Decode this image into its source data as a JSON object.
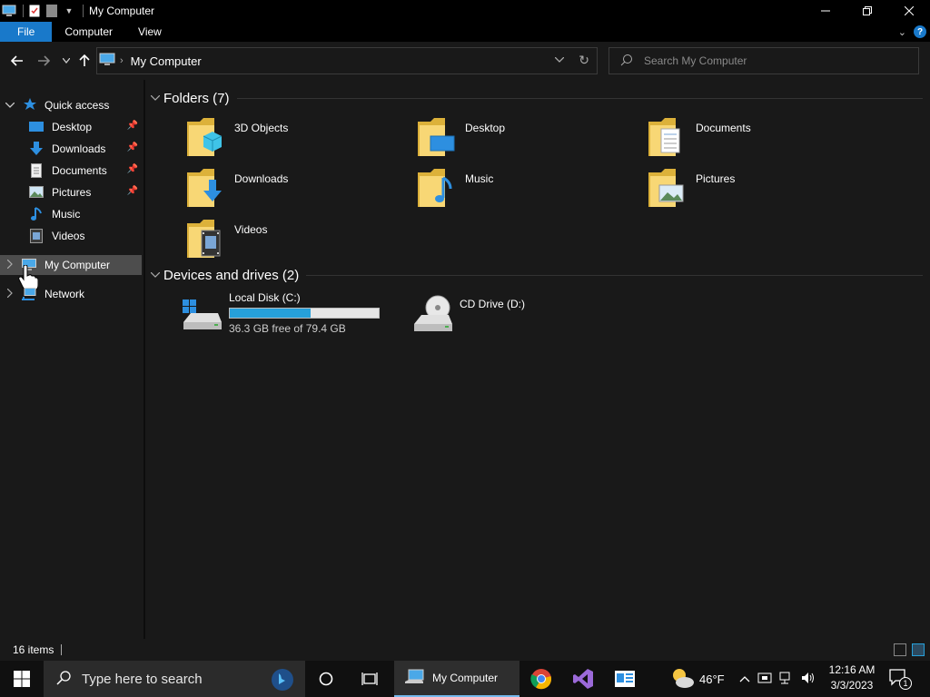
{
  "window": {
    "title": "My Computer"
  },
  "ribbon": {
    "tabs": [
      "File",
      "Computer",
      "View"
    ]
  },
  "address": {
    "path": "My Computer"
  },
  "search": {
    "placeholder": "Search My Computer"
  },
  "navpane": {
    "quick_access": "Quick access",
    "items": [
      {
        "label": "Desktop",
        "icon": "desktop-icon",
        "pinned": true
      },
      {
        "label": "Downloads",
        "icon": "downloads-icon",
        "pinned": true
      },
      {
        "label": "Documents",
        "icon": "documents-icon",
        "pinned": true
      },
      {
        "label": "Pictures",
        "icon": "pictures-icon",
        "pinned": true
      },
      {
        "label": "Music",
        "icon": "music-icon",
        "pinned": false
      },
      {
        "label": "Videos",
        "icon": "videos-icon",
        "pinned": false
      }
    ],
    "my_computer": "My Computer",
    "network": "Network"
  },
  "folders": {
    "header": "Folders (7)",
    "items": [
      {
        "name": "3D Objects",
        "icon": "3d-objects-folder-icon"
      },
      {
        "name": "Desktop",
        "icon": "desktop-folder-icon"
      },
      {
        "name": "Documents",
        "icon": "documents-folder-icon"
      },
      {
        "name": "Downloads",
        "icon": "downloads-folder-icon"
      },
      {
        "name": "Music",
        "icon": "music-folder-icon"
      },
      {
        "name": "Pictures",
        "icon": "pictures-folder-icon"
      },
      {
        "name": "Videos",
        "icon": "videos-folder-icon"
      }
    ]
  },
  "drives": {
    "header": "Devices and drives (2)",
    "items": [
      {
        "name": "Local Disk (C:)",
        "free_text": "36.3 GB free of 79.4 GB",
        "used_fraction": 0.543,
        "icon": "hard-drive-icon"
      },
      {
        "name": "CD Drive (D:)",
        "icon": "cd-drive-icon"
      }
    ]
  },
  "status": {
    "item_count": "16 items"
  },
  "taskbar": {
    "search_placeholder": "Type here to search",
    "active_app": "My Computer",
    "weather": "46°F",
    "time": "12:16 AM",
    "date": "3/3/2023",
    "notification_count": "1"
  },
  "colors": {
    "accent": "#1979ca",
    "drive_fill": "#26a0da",
    "folder": "#f8d775",
    "background": "#191919"
  }
}
